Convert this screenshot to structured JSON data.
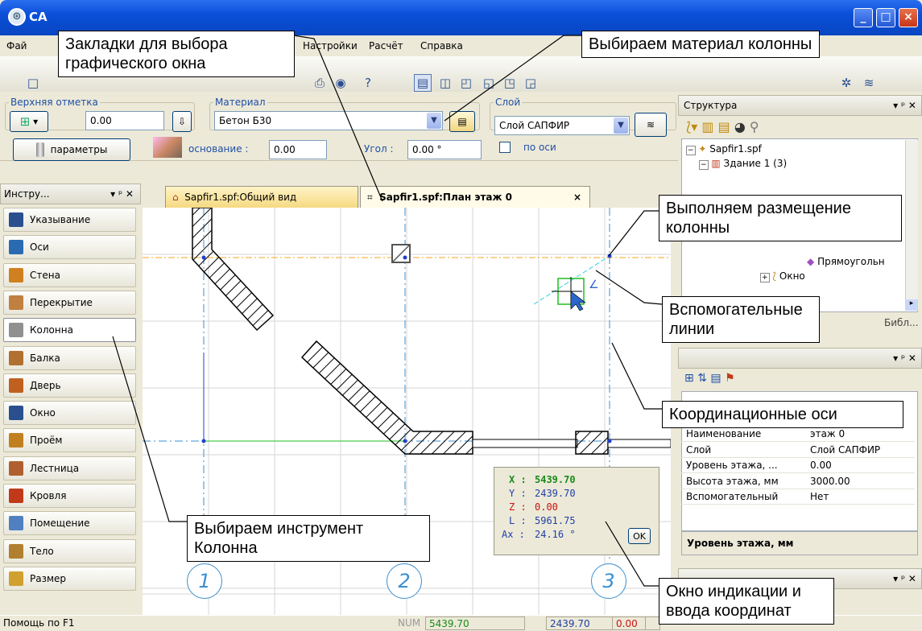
{
  "window": {
    "title": "CA",
    "icon": "sapfir-logo-icon"
  },
  "menu": [
    "Фай",
    "Настройки",
    "Расчёт",
    "Справка"
  ],
  "props": {
    "top_mark_label": "Верхняя отметка",
    "top_mark_value": "0.00",
    "material_label": "Материал",
    "material_value": "Бетон Б30",
    "layer_label": "Слой",
    "layer_value": "Слой САПФИР",
    "params_button": "параметры",
    "base_label": "основание :",
    "base_value": "0.00",
    "angle_label": "Угол :",
    "angle_value": "0.00 °",
    "axis_check_label": "по оси"
  },
  "tools": {
    "header": "Инстру...",
    "items": [
      "Указывание",
      "Оси",
      "Стена",
      "Перекрытие",
      "Колонна",
      "Балка",
      "Дверь",
      "Окно",
      "Проём",
      "Лестница",
      "Кровля",
      "Помещение",
      "Тело",
      "Размер"
    ],
    "selected": "Колонна"
  },
  "tabs": [
    "Sapfir1.spf:Общий вид",
    "Sapfir1.spf:План этаж 0"
  ],
  "tab_close": "×",
  "axes": [
    "1",
    "2",
    "3"
  ],
  "structure": {
    "title": "Структура",
    "items": [
      "Sapfir1.spf",
      "Здание 1 (3)",
      "Прямоугольн",
      "Окно"
    ],
    "lib_tab": "Библ..."
  },
  "properties": {
    "rows": [
      {
        "name": "Наименование",
        "value": "этаж 0"
      },
      {
        "name": "Слой",
        "value": "Слой САПФИР"
      },
      {
        "name": "Уровень этажа, ...",
        "value": "0.00"
      },
      {
        "name": "Высота этажа, мм",
        "value": "3000.00"
      },
      {
        "name": "Вспомогательный",
        "value": "Нет"
      }
    ],
    "footer": "Уровень этажа, мм"
  },
  "coords": {
    "x_label": "X :",
    "x": "5439.70",
    "y_label": "Y :",
    "y": "2439.70",
    "z_label": "Z :",
    "z": "0.00",
    "l_label": "L :",
    "l": "5961.75",
    "ax_label": "Ax :",
    "ax": "24.16 °",
    "ok": "OK"
  },
  "status": {
    "help": "Помощь по F1",
    "num": "NUM",
    "x": "5439.70",
    "y": "2439.70",
    "z": "0.00"
  },
  "callouts": {
    "tabs": "Закладки для выбора графического окна",
    "material": "Выбираем материал колонны",
    "place": "Выполняем размещение колонны",
    "helper": "Вспомогательные линии",
    "axes": "Координационные оси",
    "tool": "Выбираем инструмент Колонна",
    "coords": "Окно индикации и ввода координат"
  },
  "colors": {
    "accent": "#0a4fd8",
    "axis_blue": "#3a8fd0",
    "helper_orange": "#f5a623",
    "helper_cyan": "#30d0e0",
    "coord_green": "#1a8a1a",
    "coord_red": "#cc1010"
  }
}
